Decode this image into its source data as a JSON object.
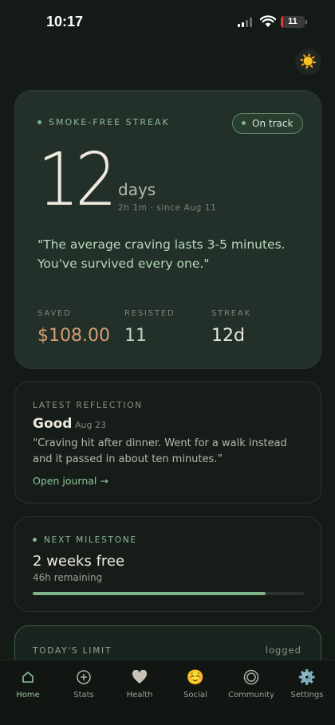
{
  "status_bar": {
    "time": "10:17",
    "battery": "11",
    "battery_level": 0.11
  },
  "theme_toggle": {
    "icon": "sun-icon"
  },
  "streak": {
    "label": "SMOKE-FREE STREAK",
    "status": "On track",
    "count": "12",
    "unit": "days",
    "since": "2h 1m · since Aug 11",
    "quote": "\"The average craving lasts 3-5 minutes. You've survived every one.\"",
    "stats": [
      {
        "label": "SAVED",
        "value": "$108.00"
      },
      {
        "label": "RESISTED",
        "value": "11"
      },
      {
        "label": "STREAK",
        "value": "12d"
      }
    ]
  },
  "reflection": {
    "label": "LATEST REFLECTION",
    "mood": "Good",
    "date": "Aug 23",
    "body": "“Craving hit after dinner. Went for a walk instead and it passed in about ten minutes.”",
    "link": "Open journal →"
  },
  "milestone": {
    "label": "NEXT MILESTONE",
    "title": "2 weeks free",
    "remaining": "46h remaining",
    "progress": 0.86
  },
  "limit": {
    "label": "TODAY'S LIMIT",
    "logged": "logged"
  },
  "tabs": [
    {
      "label": "Home",
      "icon": "home-icon",
      "active": true
    },
    {
      "label": "Stats",
      "icon": "plus-circle-icon"
    },
    {
      "label": "Health",
      "icon": "heart-icon"
    },
    {
      "label": "Social",
      "icon": "smile-icon"
    },
    {
      "label": "Community",
      "icon": "community-icon"
    },
    {
      "label": "Settings",
      "icon": "gear-icon"
    }
  ],
  "colors": {
    "accent": "#7fb58a",
    "money": "#d79d74",
    "background": "#141a16"
  }
}
